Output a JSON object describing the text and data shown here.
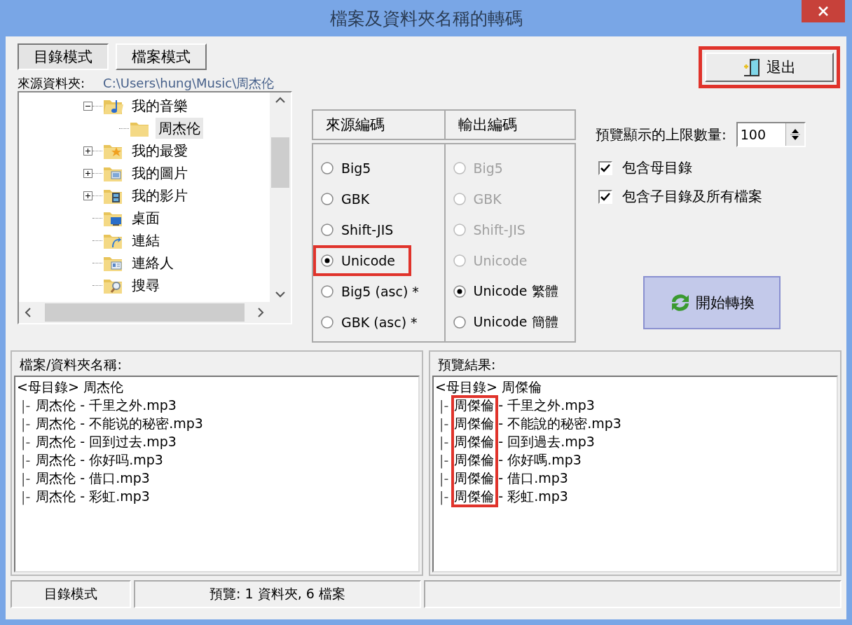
{
  "window": {
    "title": "檔案及資料夾名稱的轉碼"
  },
  "mode_tabs": [
    {
      "label": "目錄模式",
      "selected": true
    },
    {
      "label": "檔案模式",
      "selected": false
    }
  ],
  "source_folder": {
    "label": "來源資料夾:",
    "path": "C:\\Users\\hung\\Music\\周杰伦"
  },
  "folder_tree": {
    "items": [
      {
        "label": "我的音樂",
        "kind": "music",
        "expandable": true,
        "expanded": true,
        "selected": false,
        "children": [
          {
            "label": "周杰伦",
            "kind": "folder",
            "expandable": false,
            "selected": true
          }
        ]
      },
      {
        "label": "我的最愛",
        "kind": "favorites",
        "expandable": true,
        "expanded": false,
        "selected": false
      },
      {
        "label": "我的圖片",
        "kind": "pictures",
        "expandable": true,
        "expanded": false,
        "selected": false
      },
      {
        "label": "我的影片",
        "kind": "videos",
        "expandable": true,
        "expanded": false,
        "selected": false
      },
      {
        "label": "桌面",
        "kind": "desktop",
        "expandable": false,
        "selected": false
      },
      {
        "label": "連結",
        "kind": "links",
        "expandable": false,
        "selected": false
      },
      {
        "label": "連絡人",
        "kind": "contacts",
        "expandable": false,
        "selected": false
      },
      {
        "label": "搜尋",
        "kind": "search",
        "expandable": false,
        "selected": false
      }
    ]
  },
  "encodings": {
    "source": {
      "header": "來源編碼",
      "options": [
        {
          "label": "Big5",
          "selected": false,
          "disabled": false,
          "highlighted": false
        },
        {
          "label": "GBK",
          "selected": false,
          "disabled": false,
          "highlighted": false
        },
        {
          "label": "Shift-JIS",
          "selected": false,
          "disabled": false,
          "highlighted": false
        },
        {
          "label": "Unicode",
          "selected": true,
          "disabled": false,
          "highlighted": true
        },
        {
          "label": "Big5 (asc) *",
          "selected": false,
          "disabled": false,
          "highlighted": false
        },
        {
          "label": "GBK (asc) *",
          "selected": false,
          "disabled": false,
          "highlighted": false
        }
      ]
    },
    "output": {
      "header": "輸出編碼",
      "options": [
        {
          "label": "Big5",
          "selected": false,
          "disabled": true,
          "highlighted": false
        },
        {
          "label": "GBK",
          "selected": false,
          "disabled": true,
          "highlighted": false
        },
        {
          "label": "Shift-JIS",
          "selected": false,
          "disabled": true,
          "highlighted": false
        },
        {
          "label": "Unicode",
          "selected": false,
          "disabled": true,
          "highlighted": false
        },
        {
          "label": "Unicode 繁體",
          "selected": true,
          "disabled": false,
          "highlighted": false
        },
        {
          "label": "Unicode 簡體",
          "selected": false,
          "disabled": false,
          "highlighted": false
        }
      ]
    }
  },
  "exit_button": {
    "label": "退出",
    "highlighted": true
  },
  "preview_limit": {
    "label": "預覽顯示的上限數量:",
    "value": "100"
  },
  "options": [
    {
      "label": "包含母目錄",
      "checked": true
    },
    {
      "label": "包含子目錄及所有檔案",
      "checked": true
    }
  ],
  "convert_button": {
    "label": "開始轉換"
  },
  "panels": [
    {
      "header": "檔案/資料夾名稱:",
      "highlight_names": false,
      "root": {
        "prefix": "<母目錄>",
        "name": "周杰伦"
      },
      "files": [
        {
          "prefix": "|-",
          "name": "周杰伦",
          "rest": "- 千里之外.mp3"
        },
        {
          "prefix": "|-",
          "name": "周杰伦",
          "rest": "- 不能说的秘密.mp3"
        },
        {
          "prefix": "|-",
          "name": "周杰伦",
          "rest": "- 回到过去.mp3"
        },
        {
          "prefix": "|-",
          "name": "周杰伦",
          "rest": "- 你好吗.mp3"
        },
        {
          "prefix": "|-",
          "name": "周杰伦",
          "rest": "- 借口.mp3"
        },
        {
          "prefix": "|-",
          "name": "周杰伦",
          "rest": "- 彩虹.mp3"
        }
      ]
    },
    {
      "header": "預覽結果:",
      "highlight_names": true,
      "root": {
        "prefix": "<母目錄>",
        "name": "周傑倫"
      },
      "files": [
        {
          "prefix": "|-",
          "name": "周傑倫",
          "rest": "- 千里之外.mp3"
        },
        {
          "prefix": "|-",
          "name": "周傑倫",
          "rest": "- 不能說的秘密.mp3"
        },
        {
          "prefix": "|-",
          "name": "周傑倫",
          "rest": "- 回到過去.mp3"
        },
        {
          "prefix": "|-",
          "name": "周傑倫",
          "rest": "- 你好嗎.mp3"
        },
        {
          "prefix": "|-",
          "name": "周傑倫",
          "rest": "- 借口.mp3"
        },
        {
          "prefix": "|-",
          "name": "周傑倫",
          "rest": "- 彩虹.mp3"
        }
      ]
    }
  ],
  "status_bar": [
    {
      "text": "目錄模式"
    },
    {
      "text": "預覽: 1 資料夾, 6 檔案"
    }
  ]
}
